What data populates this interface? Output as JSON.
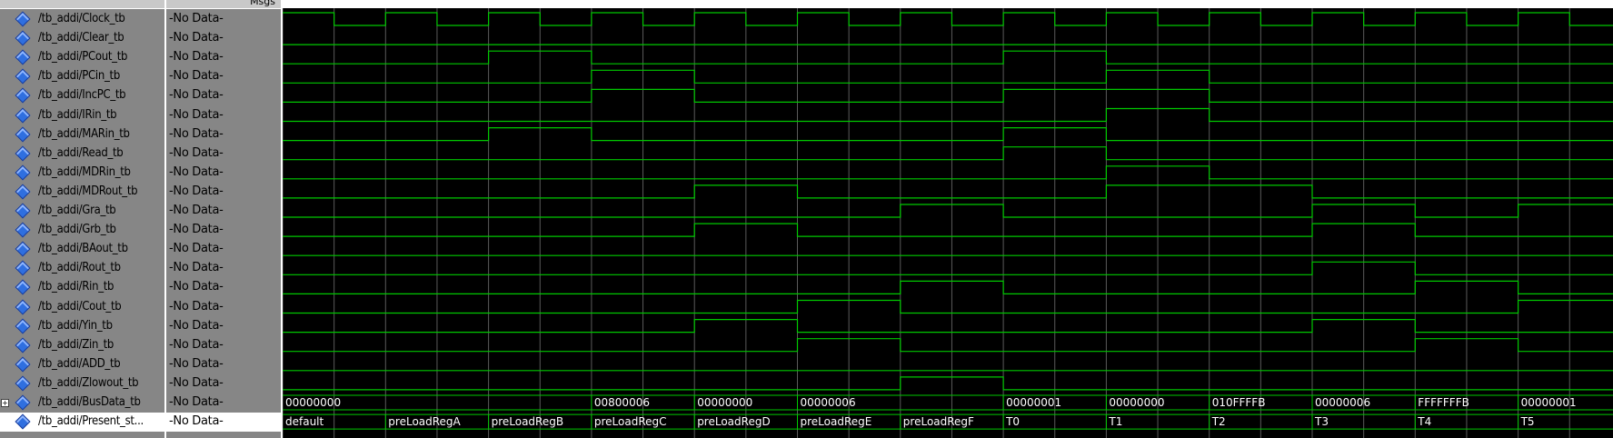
{
  "header": {
    "msgs_label": "Msgs"
  },
  "signals": [
    {
      "name": "/tb_addi/Clock_tb",
      "value": "-No Data-"
    },
    {
      "name": "/tb_addi/Clear_tb",
      "value": "-No Data-"
    },
    {
      "name": "/tb_addi/PCout_tb",
      "value": "-No Data-"
    },
    {
      "name": "/tb_addi/PCin_tb",
      "value": "-No Data-"
    },
    {
      "name": "/tb_addi/IncPC_tb",
      "value": "-No Data-"
    },
    {
      "name": "/tb_addi/IRin_tb",
      "value": "-No Data-"
    },
    {
      "name": "/tb_addi/MARin_tb",
      "value": "-No Data-"
    },
    {
      "name": "/tb_addi/Read_tb",
      "value": "-No Data-"
    },
    {
      "name": "/tb_addi/MDRin_tb",
      "value": "-No Data-"
    },
    {
      "name": "/tb_addi/MDRout_tb",
      "value": "-No Data-"
    },
    {
      "name": "/tb_addi/Gra_tb",
      "value": "-No Data-"
    },
    {
      "name": "/tb_addi/Grb_tb",
      "value": "-No Data-"
    },
    {
      "name": "/tb_addi/BAout_tb",
      "value": "-No Data-"
    },
    {
      "name": "/tb_addi/Rout_tb",
      "value": "-No Data-"
    },
    {
      "name": "/tb_addi/Rin_tb",
      "value": "-No Data-"
    },
    {
      "name": "/tb_addi/Cout_tb",
      "value": "-No Data-"
    },
    {
      "name": "/tb_addi/Yin_tb",
      "value": "-No Data-"
    },
    {
      "name": "/tb_addi/Zin_tb",
      "value": "-No Data-"
    },
    {
      "name": "/tb_addi/ADD_tb",
      "value": "-No Data-"
    },
    {
      "name": "/tb_addi/Zlowout_tb",
      "value": "-No Data-"
    },
    {
      "name": "/tb_addi/BusData_tb",
      "value": "-No Data-",
      "expandable": true
    },
    {
      "name": "/tb_addi/Present_st...",
      "value": "-No Data-",
      "selected": true
    }
  ],
  "bus_values": [
    "00000000",
    "00800006",
    "00000000",
    "00000006",
    "00000001",
    "00000000",
    "010FFFFB",
    "00000006",
    "FFFFFFFB",
    "00000001"
  ],
  "state_values": [
    "default",
    "preLoadRegA",
    "preLoadRegB",
    "preLoadRegC",
    "preLoadRegD",
    "preLoadRegE",
    "preLoadRegF",
    "T0",
    "T1",
    "T2",
    "T3",
    "T4",
    "T5"
  ],
  "colors": {
    "wave": "#00c800",
    "grid": "#5a5a5a",
    "pane_bg": "#868686",
    "wave_bg": "#000000",
    "icon": "#2f6fe0"
  },
  "icons": {
    "signal": "diamond-icon",
    "expand": "plus-box-icon"
  }
}
